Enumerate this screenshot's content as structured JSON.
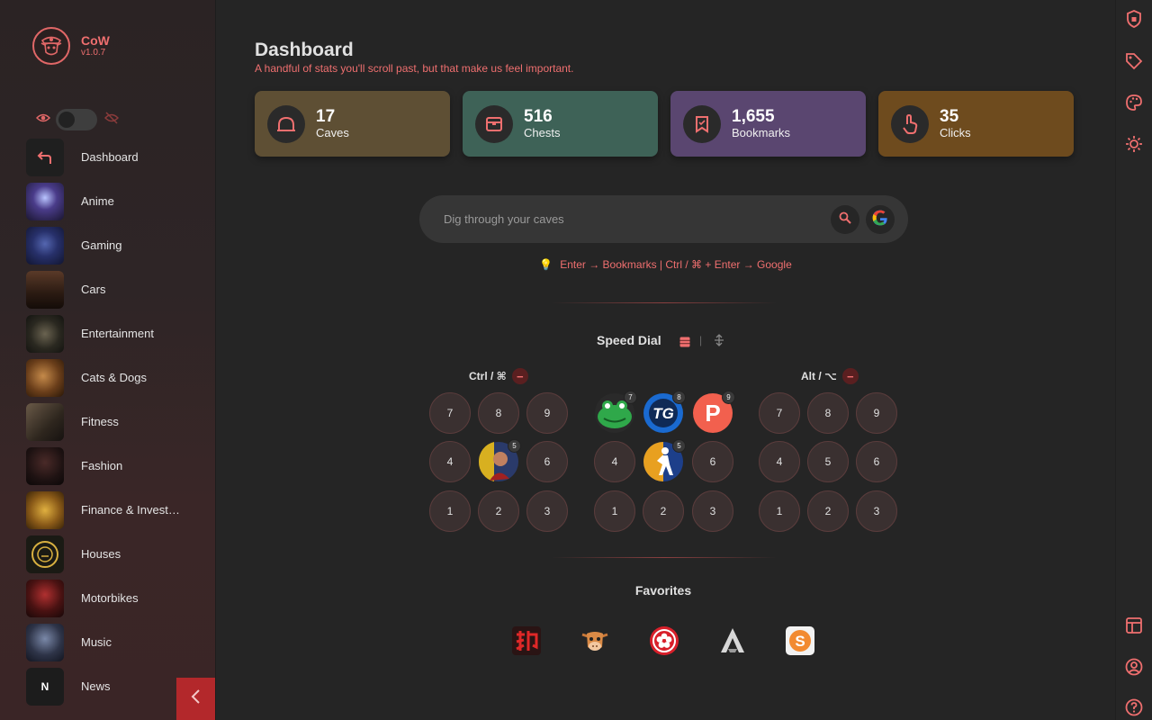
{
  "brand": {
    "name": "CoW",
    "version": "v1.0.7",
    "logo_icon": "pirate-cow-logo"
  },
  "visibility": {
    "show_icon": "eye-icon",
    "hide_icon": "eye-off-icon",
    "toggle_on": false
  },
  "sidebar": {
    "items": [
      {
        "label": "Dashboard",
        "icon": "return-arrow-icon"
      },
      {
        "label": "Anime",
        "icon": "anime-thumb"
      },
      {
        "label": "Gaming",
        "icon": "gaming-thumb"
      },
      {
        "label": "Cars",
        "icon": "cars-thumb"
      },
      {
        "label": "Entertainment",
        "icon": "entertainment-thumb"
      },
      {
        "label": "Cats & Dogs",
        "icon": "cats-dogs-thumb"
      },
      {
        "label": "Fitness",
        "icon": "fitness-thumb"
      },
      {
        "label": "Fashion",
        "icon": "fashion-thumb"
      },
      {
        "label": "Finance & Invest…",
        "icon": "finance-thumb"
      },
      {
        "label": "Houses",
        "icon": "houses-thumb"
      },
      {
        "label": "Motorbikes",
        "icon": "motorbikes-thumb"
      },
      {
        "label": "Music",
        "icon": "music-thumb"
      },
      {
        "label": "News",
        "icon": "news-thumb",
        "letter": "N"
      }
    ],
    "collapse_icon": "chevron-left-icon"
  },
  "rail": {
    "top_icons": [
      "shield-icon",
      "tag-icon",
      "palette-icon",
      "sun-icon"
    ],
    "bottom_icons": [
      "layout-icon",
      "user-circle-icon",
      "help-icon"
    ]
  },
  "dashboard": {
    "title": "Dashboard",
    "subtitle": "A handful of stats you'll scroll past, but that make us feel important."
  },
  "stats": [
    {
      "value": "17",
      "label": "Caves",
      "icon": "cave-icon",
      "color": "#5e4f34"
    },
    {
      "value": "516",
      "label": "Chests",
      "icon": "chest-icon",
      "color": "#3e6257"
    },
    {
      "value": "1,655",
      "label": "Bookmarks",
      "icon": "bookmark-icon",
      "color": "#5a4670"
    },
    {
      "value": "35",
      "label": "Clicks",
      "icon": "pointer-icon",
      "color": "#6e4b1e"
    }
  ],
  "search": {
    "placeholder": "Dig through your caves",
    "search_icon": "search-icon",
    "google_icon": "google-icon",
    "hint": "Enter → Bookmarks | Ctrl / ⌘ + Enter → Google",
    "hint_icon": "bulb-icon"
  },
  "speed_dial": {
    "title": "Speed Dial",
    "separator": "|",
    "groups": [
      {
        "label": "Ctrl / ⌘",
        "minus": "−",
        "slots": [
          {
            "n": "7"
          },
          {
            "n": "8"
          },
          {
            "n": "9"
          },
          {
            "n": "4"
          },
          {
            "n": "5",
            "site": "avatar-icon",
            "badge": "5"
          },
          {
            "n": "6"
          },
          {
            "n": "1"
          },
          {
            "n": "2"
          },
          {
            "n": "3"
          }
        ]
      },
      {
        "label": "",
        "slots": [
          {
            "n": "7",
            "site": "frog-icon",
            "badge": "7"
          },
          {
            "n": "8",
            "site": "tg-icon",
            "badge": "8"
          },
          {
            "n": "9",
            "site": "p-icon",
            "badge": "9"
          },
          {
            "n": "4"
          },
          {
            "n": "5",
            "site": "counter-strike-icon",
            "badge": "5"
          },
          {
            "n": "6"
          },
          {
            "n": "1"
          },
          {
            "n": "2"
          },
          {
            "n": "3"
          }
        ]
      },
      {
        "label": "Alt / ⌥",
        "minus": "−",
        "slots": [
          {
            "n": "7"
          },
          {
            "n": "8"
          },
          {
            "n": "9"
          },
          {
            "n": "4"
          },
          {
            "n": "5"
          },
          {
            "n": "6"
          },
          {
            "n": "1"
          },
          {
            "n": "2"
          },
          {
            "n": "3"
          }
        ]
      }
    ]
  },
  "favorites": {
    "title": "Favorites",
    "items": [
      "red-glyph-icon",
      "cow-face-icon",
      "flower-circle-icon",
      "assassin-creed-icon",
      "orange-s-icon"
    ]
  }
}
